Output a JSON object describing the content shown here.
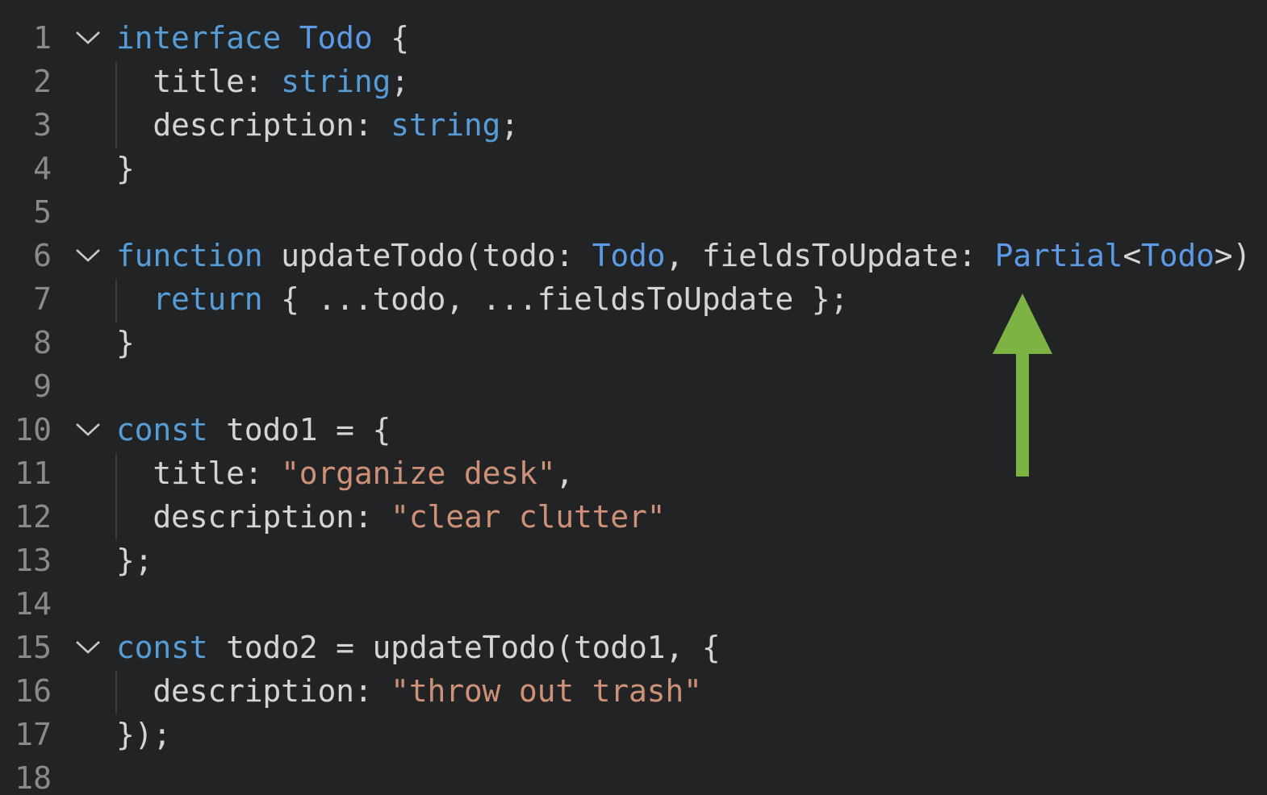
{
  "editor": {
    "lines": [
      {
        "n": "1",
        "fold": true,
        "tokens": [
          {
            "t": "interface",
            "c": "kw"
          },
          {
            "t": " ",
            "c": "pl"
          },
          {
            "t": "Todo",
            "c": "tp"
          },
          {
            "t": " {",
            "c": "pl"
          }
        ]
      },
      {
        "n": "2",
        "fold": false,
        "tokens": [
          {
            "t": "  title: ",
            "c": "pl"
          },
          {
            "t": "string",
            "c": "kw"
          },
          {
            "t": ";",
            "c": "pl"
          }
        ]
      },
      {
        "n": "3",
        "fold": false,
        "tokens": [
          {
            "t": "  description: ",
            "c": "pl"
          },
          {
            "t": "string",
            "c": "kw"
          },
          {
            "t": ";",
            "c": "pl"
          }
        ]
      },
      {
        "n": "4",
        "fold": false,
        "tokens": [
          {
            "t": "}",
            "c": "pl"
          }
        ]
      },
      {
        "n": "5",
        "fold": false,
        "tokens": []
      },
      {
        "n": "6",
        "fold": true,
        "tokens": [
          {
            "t": "function",
            "c": "kw"
          },
          {
            "t": " updateTodo(todo: ",
            "c": "pl"
          },
          {
            "t": "Todo",
            "c": "tp"
          },
          {
            "t": ", fieldsToUpdate: ",
            "c": "pl"
          },
          {
            "t": "Partial",
            "c": "tp"
          },
          {
            "t": "<",
            "c": "pl"
          },
          {
            "t": "Todo",
            "c": "tp"
          },
          {
            "t": ">) {",
            "c": "pl"
          }
        ]
      },
      {
        "n": "7",
        "fold": false,
        "tokens": [
          {
            "t": "  ",
            "c": "pl"
          },
          {
            "t": "return",
            "c": "kw"
          },
          {
            "t": " { ...todo, ...fieldsToUpdate };",
            "c": "pl"
          }
        ]
      },
      {
        "n": "8",
        "fold": false,
        "tokens": [
          {
            "t": "}",
            "c": "pl"
          }
        ]
      },
      {
        "n": "9",
        "fold": false,
        "tokens": []
      },
      {
        "n": "10",
        "fold": true,
        "tokens": [
          {
            "t": "const",
            "c": "kw"
          },
          {
            "t": " todo1 = {",
            "c": "pl"
          }
        ]
      },
      {
        "n": "11",
        "fold": false,
        "tokens": [
          {
            "t": "  title: ",
            "c": "pl"
          },
          {
            "t": "\"organize desk\"",
            "c": "str"
          },
          {
            "t": ",",
            "c": "pl"
          }
        ]
      },
      {
        "n": "12",
        "fold": false,
        "tokens": [
          {
            "t": "  description: ",
            "c": "pl"
          },
          {
            "t": "\"clear clutter\"",
            "c": "str"
          }
        ]
      },
      {
        "n": "13",
        "fold": false,
        "tokens": [
          {
            "t": "};",
            "c": "pl"
          }
        ]
      },
      {
        "n": "14",
        "fold": false,
        "tokens": []
      },
      {
        "n": "15",
        "fold": true,
        "tokens": [
          {
            "t": "const",
            "c": "kw"
          },
          {
            "t": " todo2 = updateTodo(todo1, {",
            "c": "pl"
          }
        ]
      },
      {
        "n": "16",
        "fold": false,
        "tokens": [
          {
            "t": "  description: ",
            "c": "pl"
          },
          {
            "t": "\"throw out trash\"",
            "c": "str"
          }
        ]
      },
      {
        "n": "17",
        "fold": false,
        "tokens": [
          {
            "t": "});",
            "c": "pl"
          }
        ]
      },
      {
        "n": "18",
        "fold": false,
        "tokens": []
      }
    ],
    "annotation": {
      "icon": "up-arrow-icon",
      "color": "#7cb342"
    },
    "colors": {
      "background": "#222324",
      "keyword": "#569cd6",
      "type": "#5c9ae6",
      "string": "#ce9178",
      "text": "#d4d4d4",
      "line_number": "#8a8a8a"
    }
  }
}
